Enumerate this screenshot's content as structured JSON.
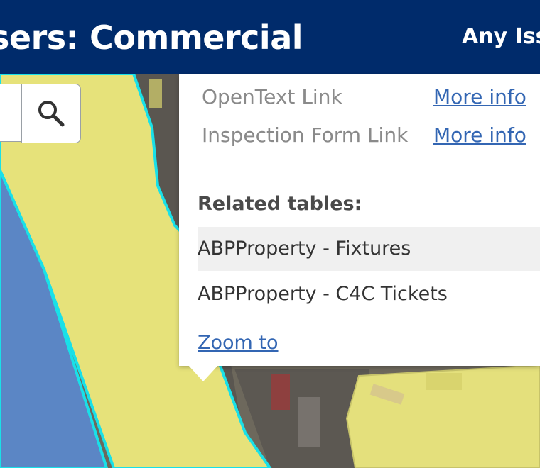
{
  "header": {
    "title": "sers: Commercial",
    "right_text": "Any Iss"
  },
  "search": {
    "button_icon": "search-icon"
  },
  "popup": {
    "attributes": [
      {
        "label": "OpenText Link",
        "link": "More info"
      },
      {
        "label": "Inspection Form Link",
        "link": "More info"
      }
    ],
    "related_heading": "Related tables:",
    "related_tables": [
      {
        "label": "ABPProperty - Fixtures"
      },
      {
        "label": "ABPProperty - C4C Tickets"
      }
    ],
    "zoom_label": "Zoom to"
  },
  "colors": {
    "header_bg": "#002b6b",
    "parcel_yellow": "#e6e27a",
    "parcel_blue": "#5b86c5",
    "parcel_outline": "#19e0e8",
    "link": "#3366b3"
  }
}
